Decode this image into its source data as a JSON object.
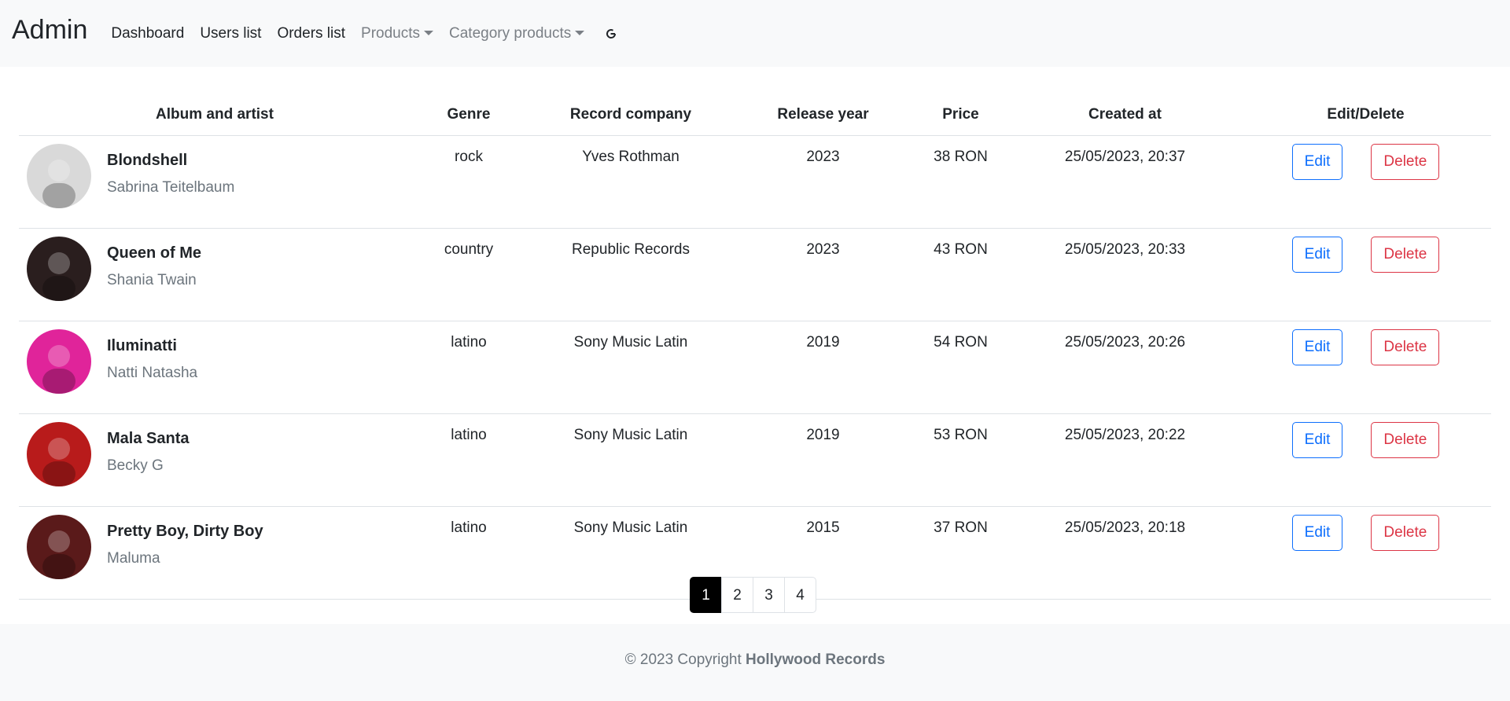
{
  "navbar": {
    "brand": "Admin",
    "links": [
      {
        "label": "Dashboard"
      },
      {
        "label": "Users list"
      },
      {
        "label": "Orders list"
      },
      {
        "label": "Products",
        "dropdown": true
      },
      {
        "label": "Category products",
        "dropdown": true
      }
    ],
    "refresh_icon": "refresh-icon"
  },
  "table": {
    "headers": [
      "Album and artist",
      "Genre",
      "Record company",
      "Release year",
      "Price",
      "Created at",
      "Edit/Delete"
    ],
    "rows": [
      {
        "album": "Blondshell",
        "artist": "Sabrina Teitelbaum",
        "genre": "rock",
        "company": "Yves Rothman",
        "year": "2023",
        "price": "38 RON",
        "created": "25/05/2023, 20:37",
        "edit": "Edit",
        "delete": "Delete",
        "cover_color": "#d9d9d9"
      },
      {
        "album": "Queen of Me",
        "artist": "Shania Twain",
        "genre": "country",
        "company": "Republic Records",
        "year": "2023",
        "price": "43 RON",
        "created": "25/05/2023, 20:33",
        "edit": "Edit",
        "delete": "Delete",
        "cover_color": "#2a1e1e"
      },
      {
        "album": "Iluminatti",
        "artist": "Natti Natasha",
        "genre": "latino",
        "company": "Sony Music Latin",
        "year": "2019",
        "price": "54 RON",
        "created": "25/05/2023, 20:26",
        "edit": "Edit",
        "delete": "Delete",
        "cover_color": "#e0249a"
      },
      {
        "album": "Mala Santa",
        "artist": "Becky G",
        "genre": "latino",
        "company": "Sony Music Latin",
        "year": "2019",
        "price": "53 RON",
        "created": "25/05/2023, 20:22",
        "edit": "Edit",
        "delete": "Delete",
        "cover_color": "#b81b1b"
      },
      {
        "album": "Pretty Boy, Dirty Boy",
        "artist": "Maluma",
        "genre": "latino",
        "company": "Sony Music Latin",
        "year": "2015",
        "price": "37 RON",
        "created": "25/05/2023, 20:18",
        "edit": "Edit",
        "delete": "Delete",
        "cover_color": "#5a1a1a"
      }
    ]
  },
  "pagination": {
    "pages": [
      "1",
      "2",
      "3",
      "4"
    ],
    "active": "1"
  },
  "footer": {
    "prefix": "© 2023 Copyright ",
    "company": "Hollywood Records"
  }
}
